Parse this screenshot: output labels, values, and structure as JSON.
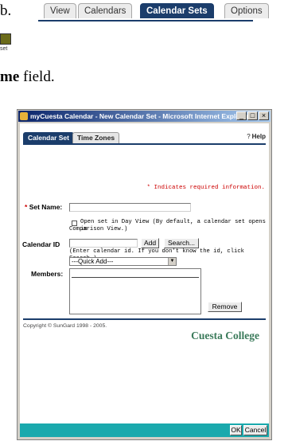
{
  "doc": {
    "line1_text": "b.",
    "line2_bold": "me",
    "line2_rest": " field.",
    "mini_label": "set"
  },
  "portal_tabs": [
    "View",
    "Calendars",
    "Calendar Sets",
    "Options"
  ],
  "portal_active_tab": "Calendar Sets",
  "window": {
    "title": "myCuesta Calendar - New Calendar Set - Microsoft Internet Explorer",
    "buttons": [
      "_",
      "□",
      "×"
    ]
  },
  "dialog": {
    "tabs": [
      "Calendar Set",
      "Time Zones"
    ],
    "active_tab": "Calendar Set",
    "help_label": "Help",
    "help_icon": "?",
    "required_note": "* Indicates required information.",
    "set_name_label": "Set Name:",
    "required_marker": "*",
    "set_name_value": "",
    "open_day_view_text_1": "Open set in Day View (By default, a calendar set opens in",
    "open_day_view_text_2": "Comparison View.)",
    "open_day_view_checked": false,
    "calendar_id_label": "Calendar ID",
    "calendar_id_value": "",
    "add_button": "Add",
    "search_button": "Search...",
    "calendar_id_hint": "(Enter calendar id. If you don't know the id, click Search.)",
    "quick_add_value": "---Quick Add---",
    "members_label": "Members:",
    "remove_button": "Remove",
    "copyright": "Copyright © SunGard 1998 - 2005.",
    "college_name": "Cuesta College",
    "ok_button": "OK",
    "cancel_button": "Cancel"
  },
  "colors": {
    "navy": "#1b3d6b",
    "teal_footer": "#1aa9ad",
    "required_red": "#cc0000",
    "college_green": "#3a7a5a"
  }
}
